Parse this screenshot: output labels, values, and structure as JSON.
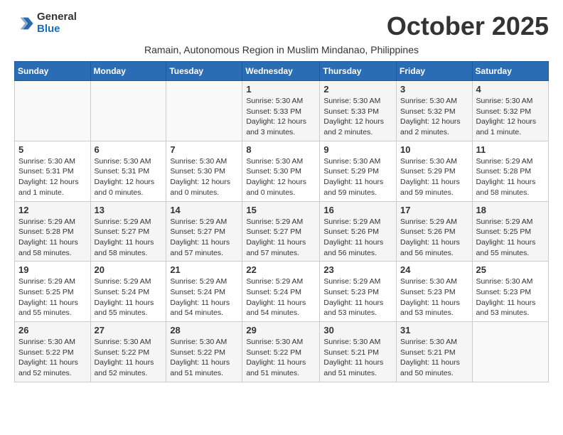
{
  "logo": {
    "general": "General",
    "blue": "Blue"
  },
  "title": "October 2025",
  "subtitle": "Ramain, Autonomous Region in Muslim Mindanao, Philippines",
  "days_header": [
    "Sunday",
    "Monday",
    "Tuesday",
    "Wednesday",
    "Thursday",
    "Friday",
    "Saturday"
  ],
  "weeks": [
    [
      {
        "day": "",
        "info": ""
      },
      {
        "day": "",
        "info": ""
      },
      {
        "day": "",
        "info": ""
      },
      {
        "day": "1",
        "info": "Sunrise: 5:30 AM\nSunset: 5:33 PM\nDaylight: 12 hours\nand 3 minutes."
      },
      {
        "day": "2",
        "info": "Sunrise: 5:30 AM\nSunset: 5:33 PM\nDaylight: 12 hours\nand 2 minutes."
      },
      {
        "day": "3",
        "info": "Sunrise: 5:30 AM\nSunset: 5:32 PM\nDaylight: 12 hours\nand 2 minutes."
      },
      {
        "day": "4",
        "info": "Sunrise: 5:30 AM\nSunset: 5:32 PM\nDaylight: 12 hours\nand 1 minute."
      }
    ],
    [
      {
        "day": "5",
        "info": "Sunrise: 5:30 AM\nSunset: 5:31 PM\nDaylight: 12 hours\nand 1 minute."
      },
      {
        "day": "6",
        "info": "Sunrise: 5:30 AM\nSunset: 5:31 PM\nDaylight: 12 hours\nand 0 minutes."
      },
      {
        "day": "7",
        "info": "Sunrise: 5:30 AM\nSunset: 5:30 PM\nDaylight: 12 hours\nand 0 minutes."
      },
      {
        "day": "8",
        "info": "Sunrise: 5:30 AM\nSunset: 5:30 PM\nDaylight: 12 hours\nand 0 minutes."
      },
      {
        "day": "9",
        "info": "Sunrise: 5:30 AM\nSunset: 5:29 PM\nDaylight: 11 hours\nand 59 minutes."
      },
      {
        "day": "10",
        "info": "Sunrise: 5:30 AM\nSunset: 5:29 PM\nDaylight: 11 hours\nand 59 minutes."
      },
      {
        "day": "11",
        "info": "Sunrise: 5:29 AM\nSunset: 5:28 PM\nDaylight: 11 hours\nand 58 minutes."
      }
    ],
    [
      {
        "day": "12",
        "info": "Sunrise: 5:29 AM\nSunset: 5:28 PM\nDaylight: 11 hours\nand 58 minutes."
      },
      {
        "day": "13",
        "info": "Sunrise: 5:29 AM\nSunset: 5:27 PM\nDaylight: 11 hours\nand 58 minutes."
      },
      {
        "day": "14",
        "info": "Sunrise: 5:29 AM\nSunset: 5:27 PM\nDaylight: 11 hours\nand 57 minutes."
      },
      {
        "day": "15",
        "info": "Sunrise: 5:29 AM\nSunset: 5:27 PM\nDaylight: 11 hours\nand 57 minutes."
      },
      {
        "day": "16",
        "info": "Sunrise: 5:29 AM\nSunset: 5:26 PM\nDaylight: 11 hours\nand 56 minutes."
      },
      {
        "day": "17",
        "info": "Sunrise: 5:29 AM\nSunset: 5:26 PM\nDaylight: 11 hours\nand 56 minutes."
      },
      {
        "day": "18",
        "info": "Sunrise: 5:29 AM\nSunset: 5:25 PM\nDaylight: 11 hours\nand 55 minutes."
      }
    ],
    [
      {
        "day": "19",
        "info": "Sunrise: 5:29 AM\nSunset: 5:25 PM\nDaylight: 11 hours\nand 55 minutes."
      },
      {
        "day": "20",
        "info": "Sunrise: 5:29 AM\nSunset: 5:24 PM\nDaylight: 11 hours\nand 55 minutes."
      },
      {
        "day": "21",
        "info": "Sunrise: 5:29 AM\nSunset: 5:24 PM\nDaylight: 11 hours\nand 54 minutes."
      },
      {
        "day": "22",
        "info": "Sunrise: 5:29 AM\nSunset: 5:24 PM\nDaylight: 11 hours\nand 54 minutes."
      },
      {
        "day": "23",
        "info": "Sunrise: 5:29 AM\nSunset: 5:23 PM\nDaylight: 11 hours\nand 53 minutes."
      },
      {
        "day": "24",
        "info": "Sunrise: 5:30 AM\nSunset: 5:23 PM\nDaylight: 11 hours\nand 53 minutes."
      },
      {
        "day": "25",
        "info": "Sunrise: 5:30 AM\nSunset: 5:23 PM\nDaylight: 11 hours\nand 53 minutes."
      }
    ],
    [
      {
        "day": "26",
        "info": "Sunrise: 5:30 AM\nSunset: 5:22 PM\nDaylight: 11 hours\nand 52 minutes."
      },
      {
        "day": "27",
        "info": "Sunrise: 5:30 AM\nSunset: 5:22 PM\nDaylight: 11 hours\nand 52 minutes."
      },
      {
        "day": "28",
        "info": "Sunrise: 5:30 AM\nSunset: 5:22 PM\nDaylight: 11 hours\nand 51 minutes."
      },
      {
        "day": "29",
        "info": "Sunrise: 5:30 AM\nSunset: 5:22 PM\nDaylight: 11 hours\nand 51 minutes."
      },
      {
        "day": "30",
        "info": "Sunrise: 5:30 AM\nSunset: 5:21 PM\nDaylight: 11 hours\nand 51 minutes."
      },
      {
        "day": "31",
        "info": "Sunrise: 5:30 AM\nSunset: 5:21 PM\nDaylight: 11 hours\nand 50 minutes."
      },
      {
        "day": "",
        "info": ""
      }
    ]
  ]
}
